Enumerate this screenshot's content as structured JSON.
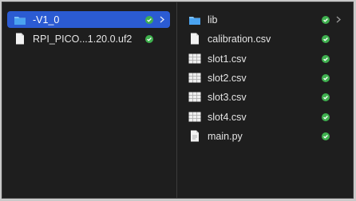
{
  "colors": {
    "window_bg": "#1e1e1e",
    "selection": "#2b5bd2",
    "folder": "#4aa3f0",
    "status_ok": "#3fb14f",
    "text": "#e4e4e4"
  },
  "left_column": {
    "items": [
      {
        "name": "-V1_0",
        "kind": "folder",
        "icon": "folder-icon",
        "status": "synced-check-icon",
        "selected": true
      },
      {
        "name": "RPI_PICO...1.20.0.uf2",
        "kind": "file",
        "icon": "document-icon",
        "status": "synced-check-icon",
        "selected": false
      }
    ]
  },
  "right_column": {
    "items": [
      {
        "name": "lib",
        "kind": "folder",
        "icon": "folder-icon",
        "status": "synced-check-icon"
      },
      {
        "name": "calibration.csv",
        "kind": "file",
        "icon": "document-icon",
        "status": "synced-check-icon"
      },
      {
        "name": "slot1.csv",
        "kind": "file",
        "icon": "spreadsheet-icon",
        "status": "synced-check-icon"
      },
      {
        "name": "slot2.csv",
        "kind": "file",
        "icon": "spreadsheet-icon",
        "status": "synced-check-icon"
      },
      {
        "name": "slot3.csv",
        "kind": "file",
        "icon": "spreadsheet-icon",
        "status": "synced-check-icon"
      },
      {
        "name": "slot4.csv",
        "kind": "file",
        "icon": "spreadsheet-icon",
        "status": "synced-check-icon"
      },
      {
        "name": "main.py",
        "kind": "file",
        "icon": "document-icon",
        "status": "synced-check-icon"
      }
    ]
  }
}
